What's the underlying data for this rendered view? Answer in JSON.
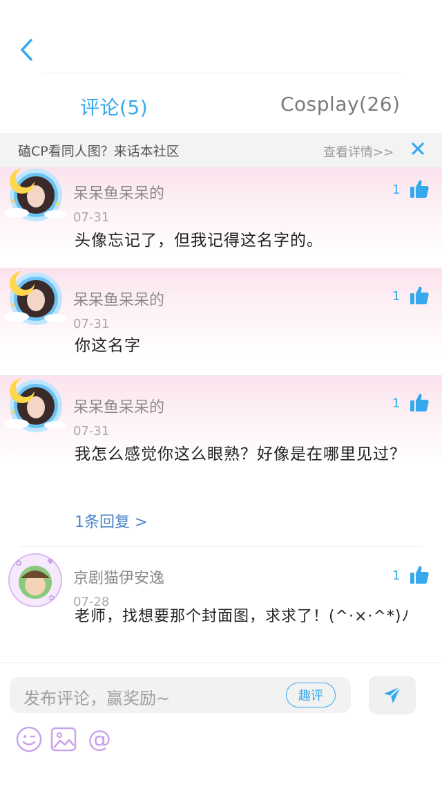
{
  "header": {
    "back_icon": "chevron-left-icon"
  },
  "tabs": [
    {
      "label": "评论(5)",
      "active": true
    },
    {
      "label": "Cosplay(26)",
      "active": false
    }
  ],
  "banner": {
    "text": "磕CP看同人图？来话本社区",
    "details": "查看详情>>",
    "close_icon": "close-icon"
  },
  "comments": [
    {
      "user": "呆呆鱼呆呆的",
      "date": "07-31",
      "text": "头像忘记了，但我记得这名字的。",
      "likes": "1"
    },
    {
      "user": "呆呆鱼呆呆的",
      "date": "07-31",
      "text": "你这名字",
      "likes": "1"
    },
    {
      "user": "呆呆鱼呆呆的",
      "date": "07-31",
      "text": "我怎么感觉你这么眼熟？好像是在哪里见过？",
      "likes": "1",
      "replies": "1条回复 >"
    },
    {
      "user": "京剧猫伊安逸",
      "date": "07-28",
      "text": "老师，找想要那个封面图，求求了！(^·×·^*)ﾉ",
      "likes": "1"
    }
  ],
  "composer": {
    "placeholder": "发布评论，赢奖励~",
    "qupin": "趣评",
    "send_icon": "send-icon",
    "tools": [
      "emoji-icon",
      "image-icon",
      "at-icon"
    ]
  },
  "colors": {
    "accent": "#35a9ec",
    "tool": "#c9a2e8"
  }
}
